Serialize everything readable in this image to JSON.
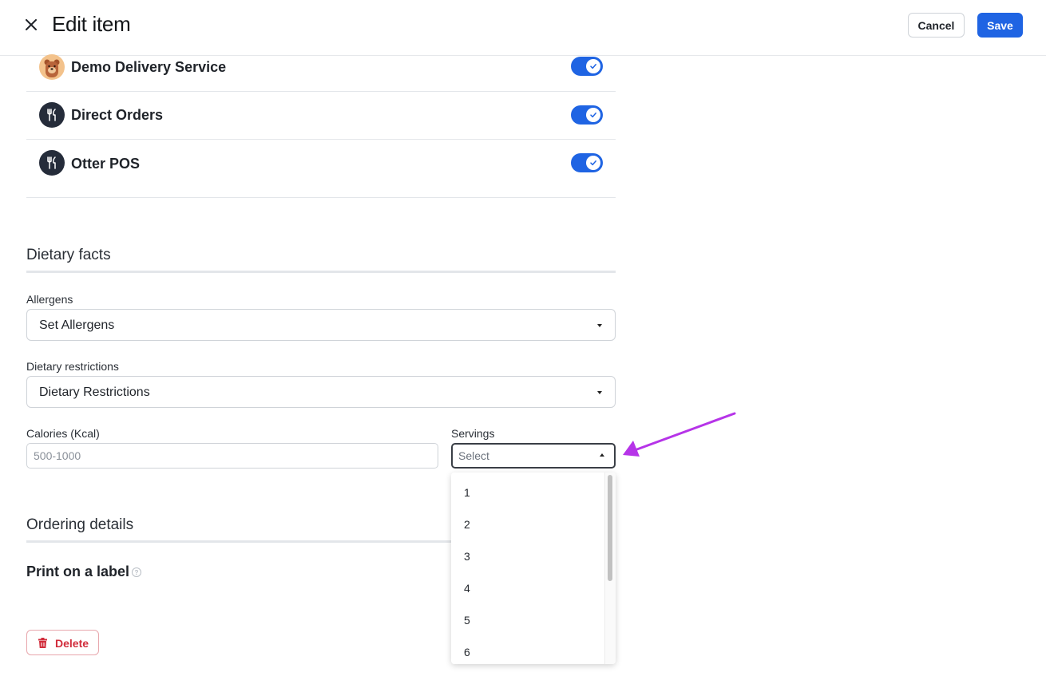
{
  "header": {
    "title": "Edit item",
    "cancel_label": "Cancel",
    "save_label": "Save"
  },
  "channels": [
    {
      "name": "Demo Delivery Service",
      "icon": "bear-avatar-icon",
      "enabled": true
    },
    {
      "name": "Direct Orders",
      "icon": "fork-knife-icon",
      "enabled": true
    },
    {
      "name": "Otter POS",
      "icon": "fork-knife-icon",
      "enabled": true
    }
  ],
  "dietary": {
    "section_title": "Dietary facts",
    "allergens_label": "Allergens",
    "allergens_value": "Set Allergens",
    "restrictions_label": "Dietary restrictions",
    "restrictions_value": "Dietary Restrictions",
    "calories_label": "Calories (Kcal)",
    "calories_placeholder": "500-1000",
    "servings_label": "Servings",
    "servings_placeholder": "Select",
    "servings_options": [
      "1",
      "2",
      "3",
      "4",
      "5",
      "6"
    ]
  },
  "ordering": {
    "section_title": "Ordering details",
    "print_label": "Print on a label",
    "help_glyph": "?"
  },
  "delete_label": "Delete",
  "colors": {
    "primary": "#1f64e3",
    "danger": "#d12c3b",
    "annotation_arrow": "#b634e8"
  }
}
